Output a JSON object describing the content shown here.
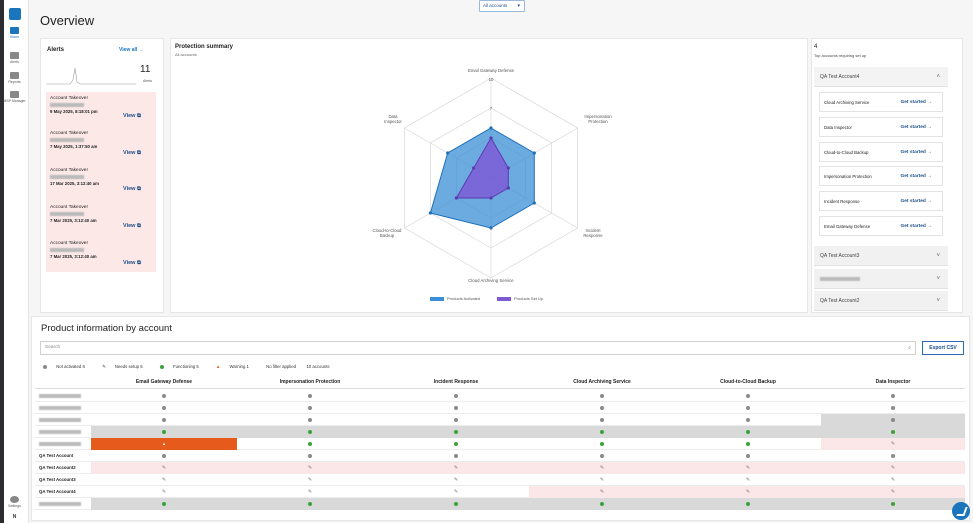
{
  "nav": {
    "items": [
      {
        "label": "Home",
        "icon": "home-icon"
      },
      {
        "label": "Alerts",
        "icon": "bell-icon"
      },
      {
        "label": "Reports",
        "icon": "report-icon"
      },
      {
        "label": "MSP Manager",
        "icon": "folder-icon"
      }
    ],
    "settings_label": "Settings",
    "user_initial": "N"
  },
  "header": {
    "title": "Overview",
    "account_selector": "All accounts"
  },
  "alerts": {
    "title": "Alerts",
    "view_all": "View all",
    "count": "11",
    "count_label": "Alerts",
    "items": [
      {
        "type": "Account Takeover",
        "date": "9 May 2025, 8:18:01 pm",
        "view": "View"
      },
      {
        "type": "Account Takeover",
        "date": "7 May 2025, 1:37:50 am",
        "view": "View"
      },
      {
        "type": "Account Takeover",
        "date": "17 Mar 2025, 3:12:40 am",
        "view": "View"
      },
      {
        "type": "Account Takeover",
        "date": "7 Mar 2025, 3:12:40 am",
        "view": "View"
      },
      {
        "type": "Account Takeover",
        "date": "7 Mar 2025, 3:12:40 am",
        "view": "View"
      }
    ]
  },
  "protection_summary": {
    "title": "Protection summary",
    "subtitle": "All accounts",
    "legend": [
      "Products Activated",
      "Products Set Up"
    ],
    "colors": {
      "activated": "#3a8fd6",
      "setup": "#7c5bd6"
    }
  },
  "chart_data": {
    "type": "radar",
    "axes": [
      "Email Gateway Defense",
      "Impersonation Protection",
      "Incident Response",
      "Cloud Archiving Service",
      "Cloud-to-Cloud Backup",
      "Data Inspector"
    ],
    "scale_labels": [
      "10",
      "7"
    ],
    "rmax": 10,
    "series": [
      {
        "name": "Products Activated",
        "values": [
          5,
          5,
          5,
          5,
          7,
          5
        ]
      },
      {
        "name": "Products Set Up",
        "values": [
          4,
          2,
          2,
          2,
          4,
          2
        ]
      }
    ]
  },
  "setup_panel": {
    "count": "4",
    "subtitle": "Top accounts requiring set up",
    "expanded_account": "QA Test Account4",
    "cards": [
      {
        "label": "Cloud Archiving Service",
        "action": "Get started"
      },
      {
        "label": "Data Inspector",
        "action": "Get started"
      },
      {
        "label": "Cloud-to-Cloud Backup",
        "action": "Get started"
      },
      {
        "label": "Impersonation Protection",
        "action": "Get started"
      },
      {
        "label": "Incident Response",
        "action": "Get started"
      },
      {
        "label": "Email Gateway Defense",
        "action": "Get started"
      }
    ],
    "collapsed_accounts": [
      "QA Test Account3",
      "",
      "QA Test Account2"
    ]
  },
  "product_info": {
    "title": "Product information by account",
    "search_placeholder": "Search",
    "export_label": "Export CSV",
    "filters": [
      "Not activated 6",
      "Needs setup 5",
      "Functioning 5",
      "Warning 1",
      "No filter applied",
      "10 accounts"
    ],
    "columns": [
      "Email Gateway Defense",
      "Impersonation Protection",
      "Incident Response",
      "Cloud Archiving Service",
      "Cloud-to-Cloud Backup",
      "Data Inspector"
    ],
    "rows": [
      {
        "name": "",
        "status": [
          "gray",
          "gray",
          "gray",
          "gray",
          "gray",
          "gray"
        ],
        "shade": [
          "",
          "",
          "",
          "",
          "",
          ""
        ]
      },
      {
        "name": "",
        "status": [
          "gray",
          "gray",
          "gray",
          "gray",
          "gray",
          "gray"
        ],
        "shade": [
          "",
          "",
          "",
          "",
          "",
          ""
        ]
      },
      {
        "name": "",
        "status": [
          "gray",
          "gray",
          "gray",
          "gray",
          "gray",
          "gray"
        ],
        "shade": [
          "",
          "",
          "",
          "",
          "",
          "grey"
        ]
      },
      {
        "name": "",
        "status": [
          "green",
          "green",
          "green",
          "green",
          "green",
          "green"
        ],
        "shade": [
          "grey",
          "grey",
          "grey",
          "grey",
          "grey",
          "grey"
        ]
      },
      {
        "name": "",
        "status": [
          "warn",
          "green",
          "green",
          "green",
          "green",
          "wrench"
        ],
        "shade": [
          "orange",
          "",
          "",
          "",
          "",
          "pink"
        ]
      },
      {
        "name": "QA Test Account",
        "status": [
          "gray",
          "gray",
          "gray",
          "gray",
          "gray",
          "gray"
        ],
        "shade": [
          "",
          "",
          "",
          "",
          "",
          ""
        ]
      },
      {
        "name": "QA Test Account2",
        "status": [
          "wrench",
          "wrench",
          "wrench",
          "wrench",
          "wrench",
          "wrench"
        ],
        "shade": [
          "pink",
          "pink",
          "pink",
          "pink",
          "pink",
          "pink"
        ]
      },
      {
        "name": "QA Test Account3",
        "status": [
          "wrench",
          "wrench",
          "wrench",
          "wrench",
          "wrench",
          "wrench"
        ],
        "shade": [
          "",
          "",
          "",
          "",
          "",
          ""
        ]
      },
      {
        "name": "QA Test Account4",
        "status": [
          "wrench",
          "wrench",
          "wrench",
          "wrench",
          "wrench",
          "wrench"
        ],
        "shade": [
          "",
          "",
          "",
          "pink",
          "pink",
          "pink"
        ]
      },
      {
        "name": "",
        "status": [
          "green",
          "green",
          "green",
          "green",
          "green",
          "green"
        ],
        "shade": [
          "grey",
          "grey",
          "grey",
          "grey",
          "grey",
          "grey"
        ]
      }
    ]
  }
}
